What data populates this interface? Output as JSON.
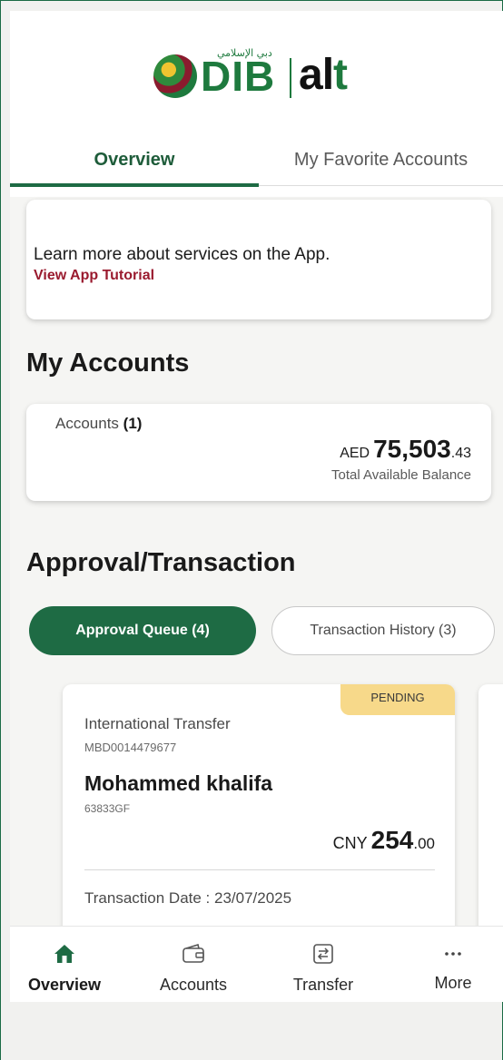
{
  "brand": {
    "arabic_name": "دبي الإسلامي",
    "name": "DIB",
    "sub_brand_prefix": "al",
    "sub_brand_suffix": "t",
    "colors": {
      "primary_green": "#1e6b44",
      "accent_red": "#9a1b2f",
      "pending_yellow": "#f7d98a"
    }
  },
  "tabs": [
    {
      "label": "Overview",
      "active": true
    },
    {
      "label": "My Favorite Accounts",
      "active": false
    }
  ],
  "tutorial": {
    "text": "Learn more about services on the App.",
    "link": "View App Tutorial"
  },
  "my_accounts": {
    "title": "My Accounts",
    "count_label": "Accounts",
    "count": "(1)",
    "currency": "AED",
    "balance_int": "75,503",
    "balance_dec": ".43",
    "balance_label": "Total Available Balance"
  },
  "approval": {
    "title": "Approval/Transaction",
    "tabs": [
      {
        "label": "Approval Queue (4)",
        "active": true
      },
      {
        "label": "Transaction History (3)",
        "active": false
      }
    ],
    "transaction": {
      "status": "PENDING",
      "type": "International Transfer",
      "reference": "MBD0014479677",
      "beneficiary": "Mohammed khalifa",
      "beneficiary_code": "63833GF",
      "currency": "CNY",
      "amount_int": "254",
      "amount_dec": ".00",
      "date_text": "Transaction Date : 23/07/2025"
    }
  },
  "bottom_nav": [
    {
      "label": "Overview",
      "icon": "home-icon",
      "active": true
    },
    {
      "label": "Accounts",
      "icon": "wallet-icon",
      "active": false
    },
    {
      "label": "Transfer",
      "icon": "transfer-icon",
      "active": false
    },
    {
      "label": "More",
      "icon": "more-dots-icon",
      "active": false
    }
  ]
}
